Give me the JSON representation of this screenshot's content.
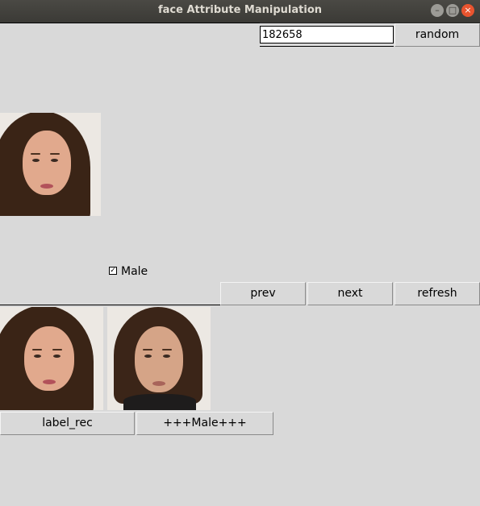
{
  "window": {
    "title": "face Attribute Manipulation"
  },
  "controls": {
    "index_value": "182658",
    "random_label": "random"
  },
  "checkbox": {
    "label": "Male",
    "checked": true
  },
  "nav": {
    "prev_label": "prev",
    "next_label": "next",
    "refresh_label": "refresh"
  },
  "results": {
    "label_rec": "label_rec",
    "attr_label": "+++Male+++"
  },
  "icons": {
    "minimize": "minimize-icon",
    "maximize": "maximize-icon",
    "close": "close-icon"
  }
}
